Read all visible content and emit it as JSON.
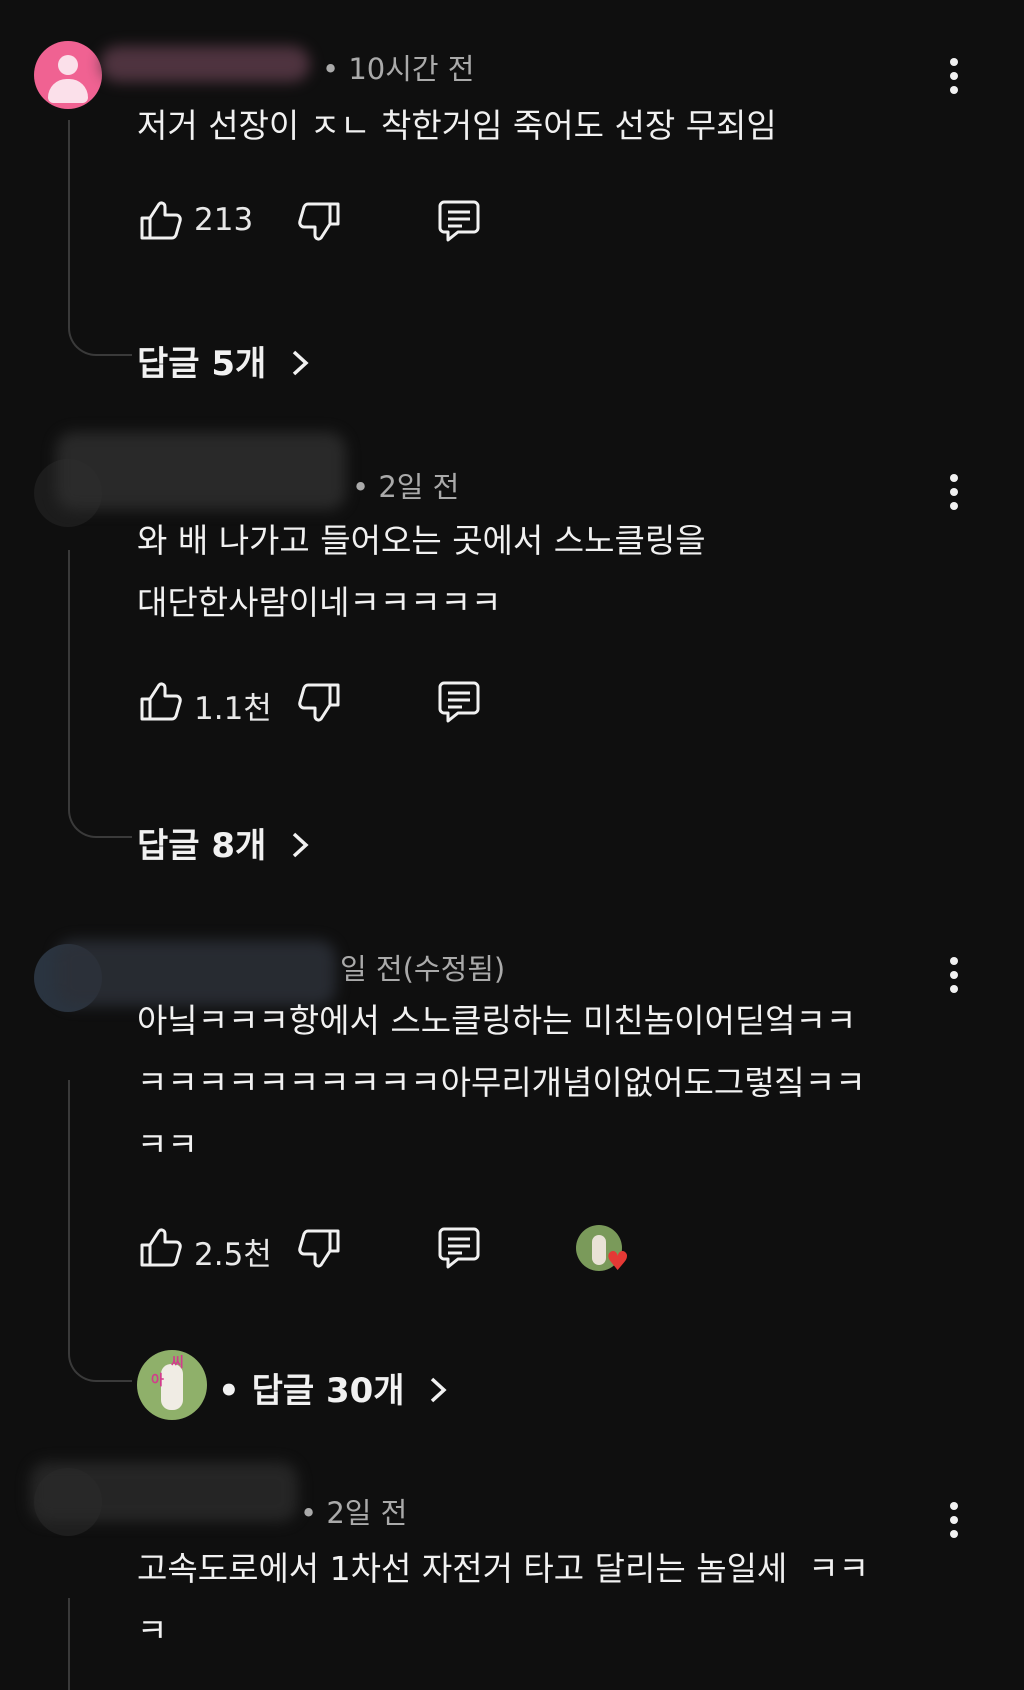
{
  "comments": [
    {
      "meta": "• 10시간 전",
      "text": "저거 선장이 ㅈㄴ 착한거임 죽어도 선장 무죄임",
      "likes": "213",
      "replies": "답글 5개"
    },
    {
      "meta": "• 2일 전",
      "text": "와 배 나가고 들어오는 곳에서 스노클링을\n대단한사람이네ㅋㅋㅋㅋㅋ",
      "likes": "1.1천",
      "replies": "답글 8개"
    },
    {
      "meta": "일 전(수정됨)",
      "text": "아닠ㅋㅋㅋ항에서 스노클링하는 미친놈이어딛엌ㅋㅋ\nㅋㅋㅋㅋㅋㅋㅋㅋㅋㅋ아무리개념이없어도그렇짘ㅋㅋ\nㅋㅋ",
      "likes": "2.5천",
      "replies": "• 답글 30개"
    },
    {
      "meta": "• 2일 전",
      "text": "고속도로에서 1차선 자전거 타고 달리는 놈일세  ㅋㅋ\nㅋ"
    }
  ],
  "icons": {
    "like": "thumb-up-icon",
    "dislike": "thumb-down-icon",
    "reply": "reply-icon",
    "more": "more-vert-icon",
    "chevron": "chevron-right-icon",
    "heart": "heart-icon"
  },
  "colors": {
    "background": "#0f0f0f",
    "text": "#f1f1f1",
    "meta": "#aaaaaa",
    "avatar_pink": "#f06292",
    "heart": "#e53935"
  }
}
